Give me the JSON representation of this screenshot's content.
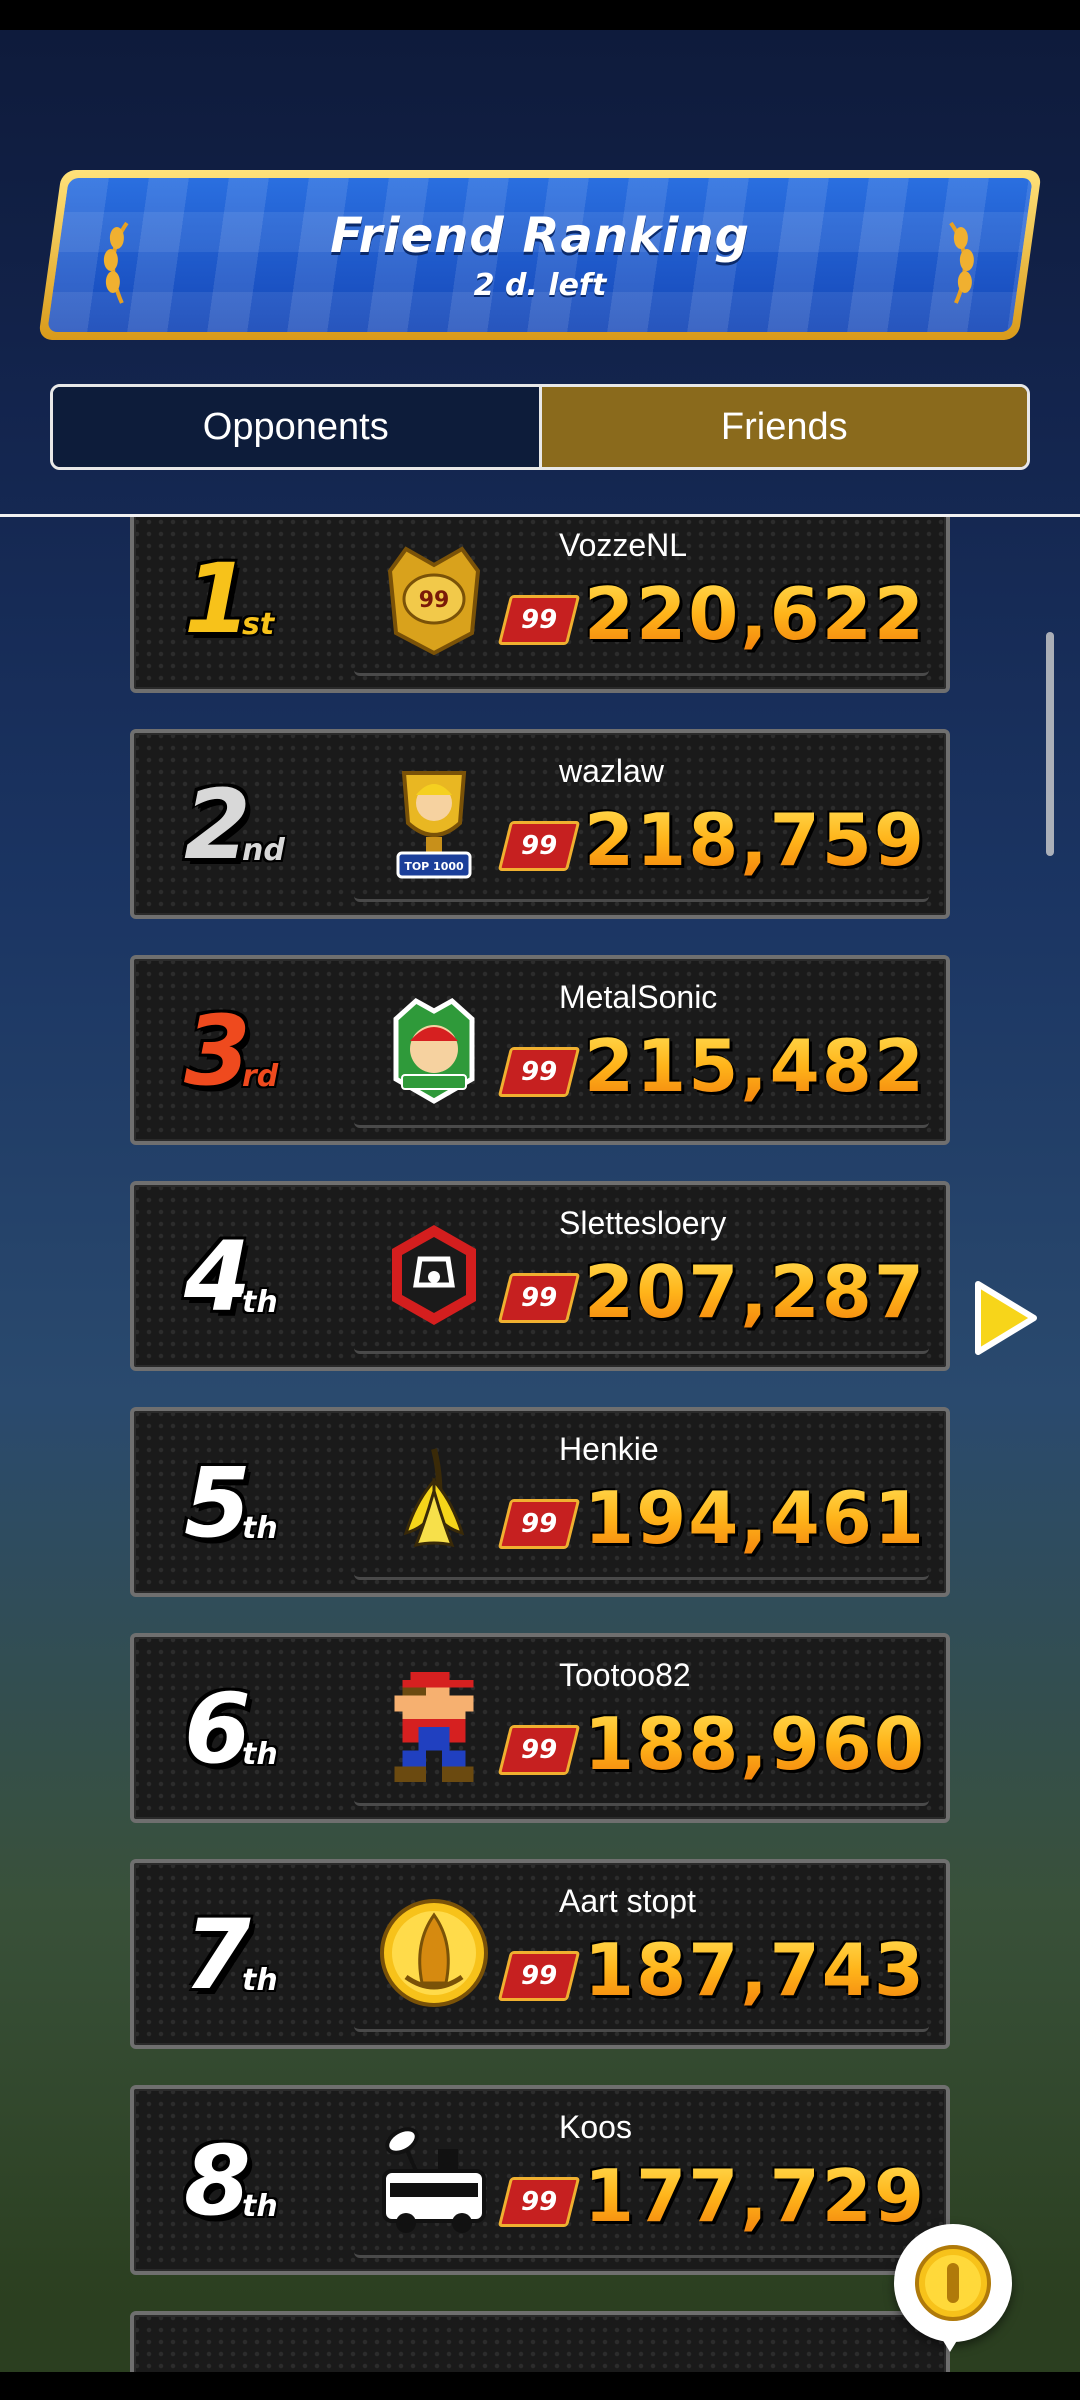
{
  "header": {
    "title": "Friend Ranking",
    "time_left": "2 d. left"
  },
  "tabs": [
    {
      "label": "Opponents",
      "selected": false
    },
    {
      "label": "Friends",
      "selected": true
    }
  ],
  "ranking": [
    {
      "rank": "1",
      "suffix": "st",
      "name": "VozzeNL",
      "level": "99",
      "score": "220,622",
      "badge": "gold-crown-badge-icon"
    },
    {
      "rank": "2",
      "suffix": "nd",
      "name": "wazlaw",
      "level": "99",
      "score": "218,759",
      "badge": "top-1000-trophy-icon"
    },
    {
      "rank": "3",
      "suffix": "rd",
      "name": "MetalSonic",
      "level": "99",
      "score": "215,482",
      "badge": "mario-emblem-badge-icon"
    },
    {
      "rank": "4",
      "suffix": "th",
      "name": "Slettesloery",
      "level": "99",
      "score": "207,287",
      "badge": "hexagon-kart-emblem-icon"
    },
    {
      "rank": "5",
      "suffix": "th",
      "name": "Henkie",
      "level": "99",
      "score": "194,461",
      "badge": "banana-peel-icon"
    },
    {
      "rank": "6",
      "suffix": "th",
      "name": "Tootoo82",
      "level": "99",
      "score": "188,960",
      "badge": "pixel-mario-icon"
    },
    {
      "rank": "7",
      "suffix": "th",
      "name": "Aart stopt",
      "level": "99",
      "score": "187,743",
      "badge": "gold-coin-emblem-icon"
    },
    {
      "rank": "8",
      "suffix": "th",
      "name": "Koos",
      "level": "99",
      "score": "177,729",
      "badge": "news-van-icon"
    }
  ],
  "colors": {
    "accent_gold": "#f7c21a",
    "friends_tab": "#8a6a1c",
    "score_orange": "#ffae1a"
  }
}
